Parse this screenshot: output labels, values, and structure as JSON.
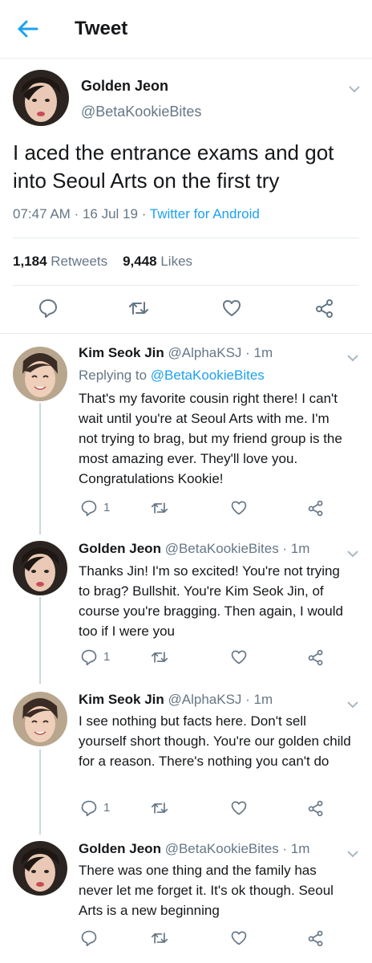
{
  "header": {
    "title": "Tweet"
  },
  "main_tweet": {
    "name": "Golden Jeon",
    "handle": "@BetaKookieBites",
    "text": "I aced the entrance exams and got into Seoul Arts on the first try",
    "time": "07:47 AM",
    "date": "16 Jul 19",
    "dot": "·",
    "source": "Twitter for Android",
    "retweets_count": "1,184",
    "retweets_label": "Retweets",
    "likes_count": "9,448",
    "likes_label": "Likes"
  },
  "replies": [
    {
      "name": "Kim Seok Jin",
      "handle": "@AlphaKSJ · 1m",
      "replying_prefix": "Replying to ",
      "replying_to": "@BetaKookieBites",
      "text": "That's my favorite cousin right there! I can't wait until you're at Seoul Arts with me. I'm not trying to brag, but my friend group is the most amazing ever. They'll love you. Congratulations Kookie!",
      "reply_count": "1"
    },
    {
      "name": "Golden Jeon",
      "handle": "@BetaKookieBites · 1m",
      "text": "Thanks Jin! I'm so excited! You're not trying to brag? Bullshit. You're Kim Seok Jin, of course you're bragging. Then again, I would too if I were you",
      "reply_count": "1"
    },
    {
      "name": "Kim Seok Jin",
      "handle": "@AlphaKSJ · 1m",
      "text": "I see nothing but facts here. Don't sell yourself short though. You're our golden child for a reason. There's nothing you can't do",
      "reply_count": "1"
    },
    {
      "name": "Golden Jeon",
      "handle": "@BetaKookieBites · 1m",
      "text": "There was one thing and the family has never let me forget it. It's ok though. Seoul Arts is a new beginning"
    }
  ],
  "icons": {
    "back": "arrow-left-icon",
    "caret": "chevron-down-icon",
    "reply": "speech-bubble-icon",
    "retweet": "retweet-icon",
    "like": "heart-icon",
    "share": "share-icon"
  },
  "colors": {
    "accent": "#1da1f2",
    "text": "#14171a",
    "muted": "#657786",
    "divider": "#e6ecf0"
  }
}
